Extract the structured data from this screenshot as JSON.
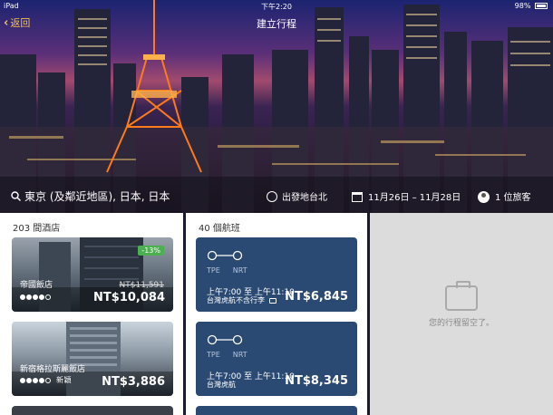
{
  "status_bar": {
    "carrier": "iPad",
    "time": "下午2:20",
    "battery": "98%"
  },
  "nav": {
    "back_label": "返回",
    "title": "建立行程"
  },
  "search": {
    "location": "東京 (及鄰近地區), 日本, 日本",
    "departure": "出發地台北",
    "dates": "11月26日 – 11月28日",
    "travelers": "1 位旅客"
  },
  "hotels": {
    "header": "203 間酒店",
    "items": [
      {
        "name": "帝國飯店",
        "old_price": "NT$11,591",
        "price": "NT$10,084",
        "badge": "-13%",
        "stars": 4,
        "tag": ""
      },
      {
        "name": "新宿格拉斯麗飯店",
        "old_price": "",
        "price": "NT$3,886",
        "badge": "",
        "stars": 4,
        "tag": "新穎"
      }
    ]
  },
  "flights": {
    "header": "40 個航班",
    "items": [
      {
        "from": "TPE",
        "to": "NRT",
        "times": "上午7:00 至 上午11:10",
        "airline": "台灣虎航不含行李",
        "price": "NT$6,845"
      },
      {
        "from": "TPE",
        "to": "NRT",
        "times": "上午7:00 至 上午11:10",
        "airline": "台灣虎航",
        "price": "NT$8,345"
      }
    ]
  },
  "trip": {
    "empty_message": "您的行程留空了。"
  },
  "colors": {
    "accent": "#f5c344",
    "flight_card": "#2b4a73",
    "badge": "#4caf50"
  }
}
